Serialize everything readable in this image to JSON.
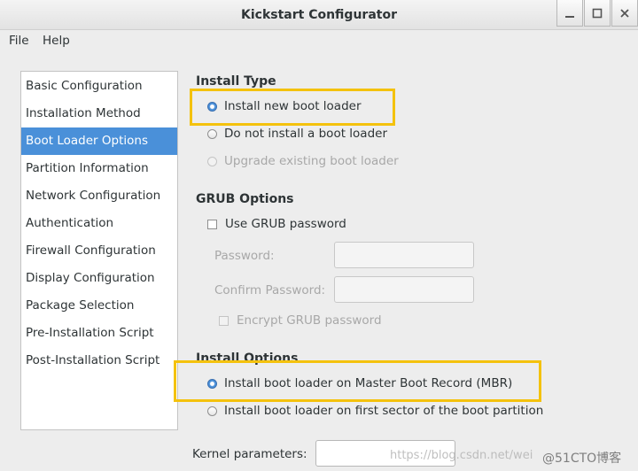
{
  "window": {
    "title": "Kickstart Configurator"
  },
  "menubar": {
    "items": [
      "File",
      "Help"
    ]
  },
  "sidebar": {
    "items": [
      "Basic Configuration",
      "Installation Method",
      "Boot Loader Options",
      "Partition Information",
      "Network Configuration",
      "Authentication",
      "Firewall Configuration",
      "Display Configuration",
      "Package Selection",
      "Pre-Installation Script",
      "Post-Installation Script"
    ],
    "selected": "Boot Loader Options"
  },
  "install_type": {
    "heading": "Install Type",
    "options": [
      "Install new boot loader",
      "Do not install a boot loader",
      "Upgrade existing boot loader"
    ],
    "selected": "Install new boot loader"
  },
  "grub": {
    "heading": "GRUB Options",
    "use_password_label": "Use GRUB password",
    "password_label": "Password:",
    "confirm_label": "Confirm Password:",
    "encrypt_label": "Encrypt GRUB password"
  },
  "install_options": {
    "heading": "Install Options",
    "options": [
      "Install boot loader on Master Boot Record (MBR)",
      "Install boot loader on first sector of the boot partition"
    ],
    "selected": "Install boot loader on Master Boot Record (MBR)"
  },
  "kernel": {
    "label": "Kernel parameters:",
    "value": ""
  },
  "watermark": {
    "url": "https://blog.csdn.net/wei",
    "brand": "@51CTO博客"
  },
  "colors": {
    "selection": "#4a90d9",
    "highlight_box": "#f4c20d"
  },
  "icons": {
    "window_controls": [
      "minimize-icon",
      "maximize-icon",
      "close-icon"
    ]
  }
}
